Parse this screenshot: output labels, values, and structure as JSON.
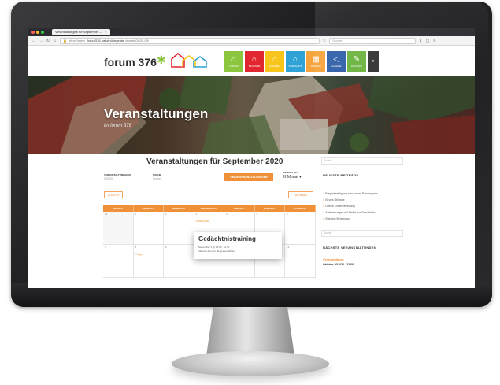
{
  "browser": {
    "tab_title": "Veranstaltungen für September –",
    "url_domain": "forum376-hallothüringe.de",
    "url_rest": "/events/2020-09/",
    "url_prefix": "https://www.",
    "search_placeholder": "Suchen"
  },
  "site": {
    "logo_text": "forum 376",
    "menu": [
      {
        "label": "forum",
        "color": "#8cc63f",
        "icon": "home-icon"
      },
      {
        "label": "Bauen 95",
        "color": "#e2262f",
        "icon": "home-icon"
      },
      {
        "label": "Wohnen",
        "color": "#f8c51c",
        "icon": "home-icon"
      },
      {
        "label": "Forum 376",
        "color": "#2fa3d6",
        "icon": "home-icon"
      },
      {
        "label": "Termine",
        "color": "#f5a33b",
        "icon": "calendar-icon"
      },
      {
        "label": "Galerie",
        "color": "#2f5fa8",
        "icon": "megaphone-icon"
      },
      {
        "label": "Kontakt",
        "color": "#6cb33f",
        "icon": "pencil-icon"
      }
    ],
    "search_glyph": "⌕"
  },
  "hero": {
    "title": "Veranstaltungen",
    "subtitle": "im forum 376"
  },
  "events_page": {
    "heading": "Veranstaltungen für September 2020",
    "filter_date_label": "Veranstaltungen in",
    "filter_date_value": "9/2020",
    "filter_search_label": "Suche",
    "filter_search_value": "Suche",
    "find_button": "Finde Veranstaltungen",
    "view_label": "Ansicht als",
    "view_value": "Monat",
    "prev_label": "« August",
    "next_label": "Oktober »",
    "weekdays": [
      "Montag",
      "Dienstag",
      "Mittwoch",
      "Donnerstag",
      "Freitag",
      "Samstag",
      "Sonntag"
    ],
    "week1": [
      "31",
      "1",
      "2",
      "3",
      "4",
      "5",
      "6"
    ],
    "week2": [
      "7",
      "8",
      "9",
      "10",
      "11",
      "12",
      "13"
    ],
    "week1_event": "Gedächtnis",
    "week2_event": "Pflege"
  },
  "popup": {
    "title": "Gedächtnistraining",
    "date": "September 3 @ 10:00 - 11:30",
    "desc": "Aktives Üben für die grauen Zellen"
  },
  "sidebar": {
    "search_placeholder": "Suche",
    "recent_heading": "Neueste Beiträge",
    "recent_posts": [
      "Bürgerbeteiligung zum neuen Rahmenplan",
      "Neues Gelände",
      "Offene Kinderbetreuung",
      "Abänderungen mit Tablet zur Geschichte",
      "Standort Betreuung"
    ],
    "search2_placeholder": "Suche",
    "upcoming_heading": "Nächste Veranstaltungen",
    "upcoming_event_title": "Veranstaltung",
    "upcoming_event_date": "Oktober 30/2020 - 22:00"
  }
}
